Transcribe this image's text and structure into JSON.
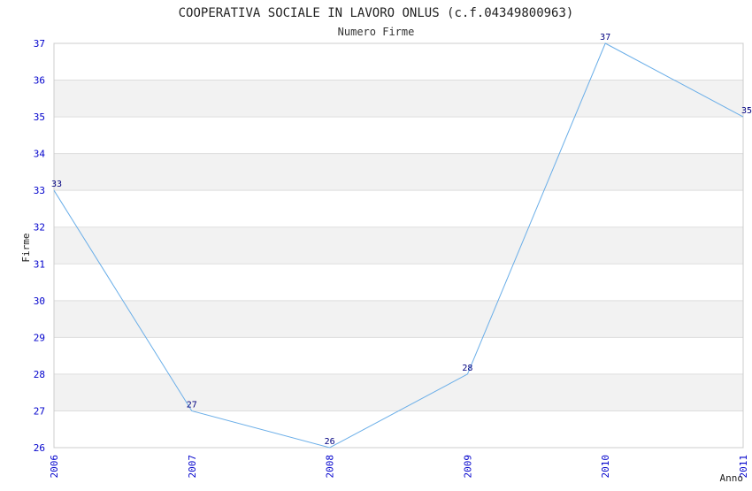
{
  "chart_data": {
    "type": "line",
    "title": "COOPERATIVA SOCIALE IN LAVORO ONLUS (c.f.04349800963)",
    "subtitle": "Numero Firme",
    "xlabel": "Anno",
    "ylabel": "Firme",
    "x": [
      "2006",
      "2007",
      "2008",
      "2009",
      "2010",
      "2011"
    ],
    "series": [
      {
        "values": [
          33,
          27,
          26,
          28,
          37,
          35
        ]
      }
    ],
    "ylim": [
      26,
      37
    ],
    "yticks": [
      26,
      27,
      28,
      29,
      30,
      31,
      32,
      33,
      34,
      35,
      36,
      37
    ],
    "grid": true,
    "colors": {
      "line": "#6aaee8",
      "band": "#f2f2f2",
      "tick": "#0000cc",
      "point_label": "#000080",
      "border": "#cccccc"
    }
  }
}
